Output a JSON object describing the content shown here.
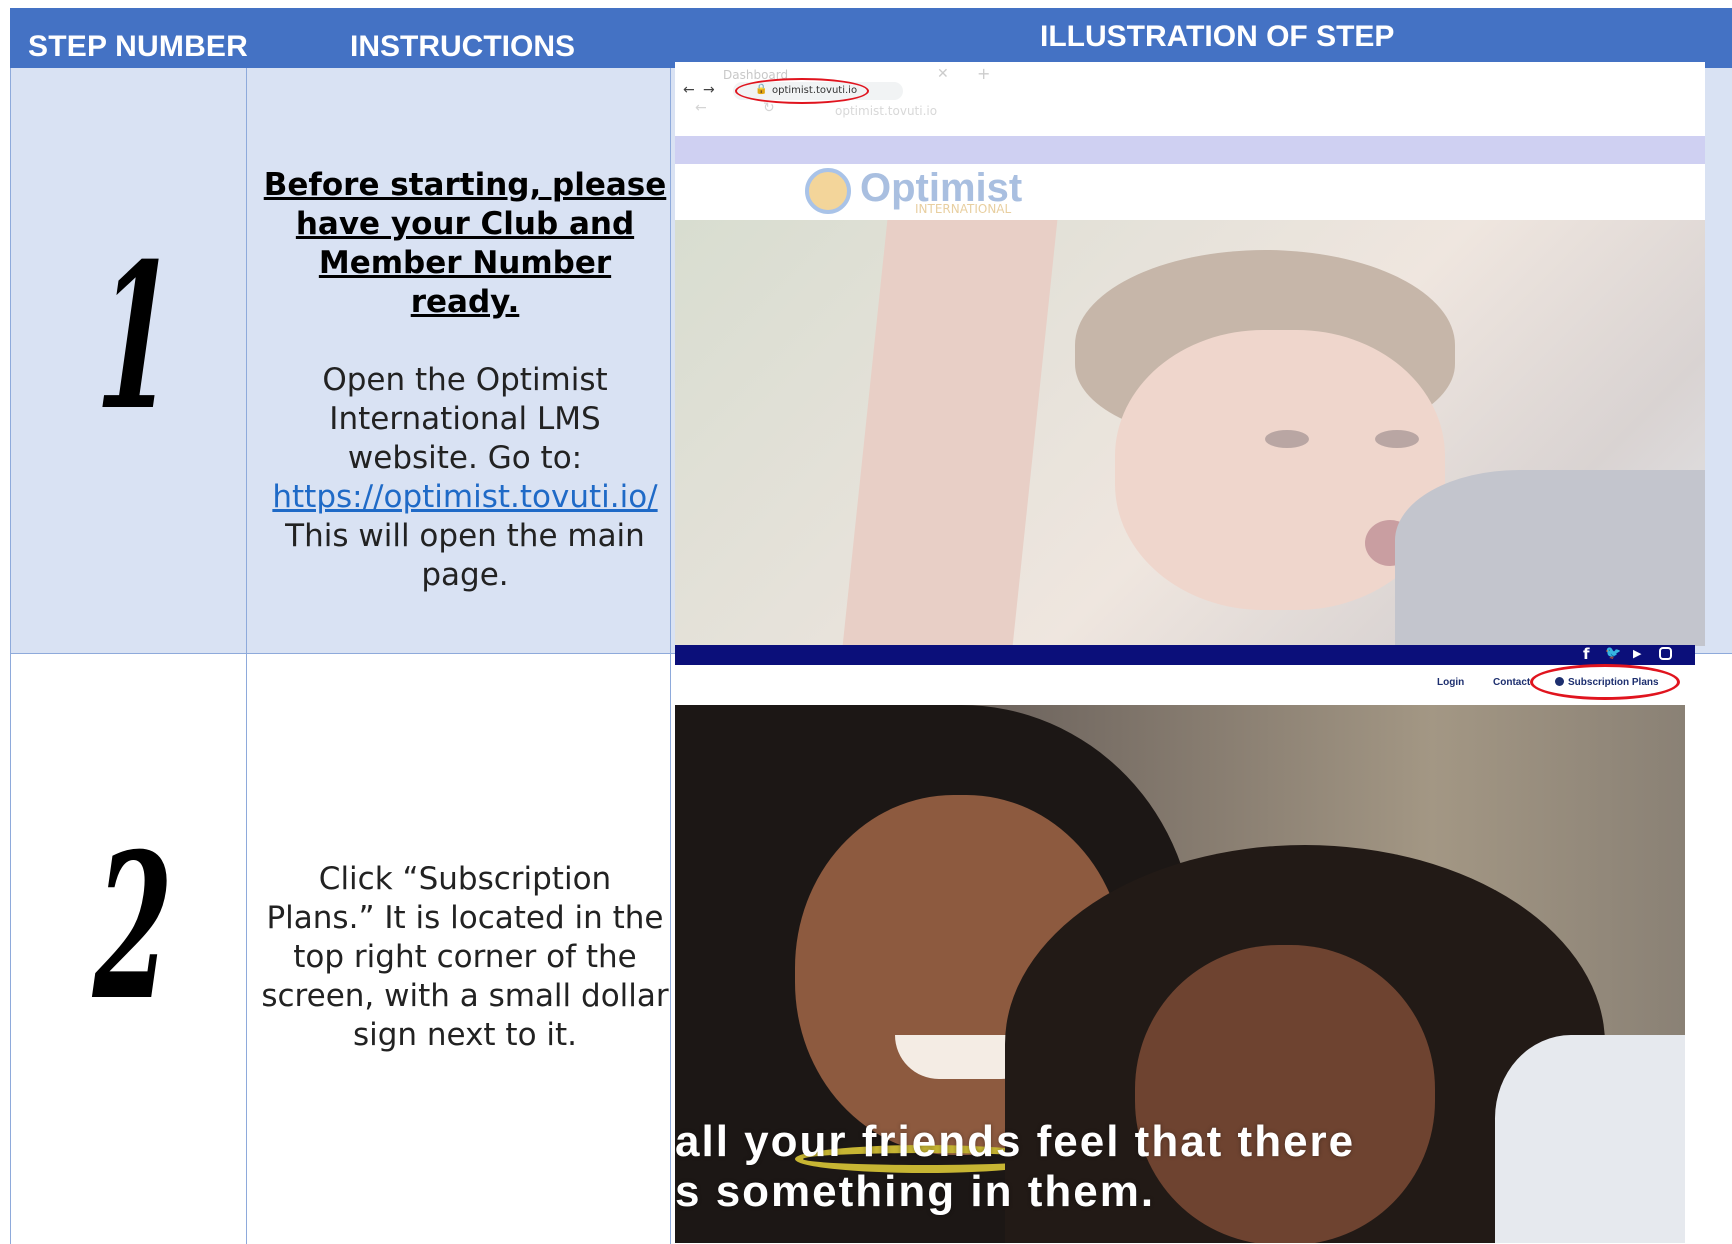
{
  "header": {
    "step_number": "STEP NUMBER",
    "instructions": "INSTRUCTIONS",
    "illustration": "ILLUSTRATION OF STEP"
  },
  "rows": [
    {
      "number": "1",
      "instruction_bold": "Before starting, please have your Club and Member Number ready.",
      "instruction_text": "Open the Optimist International LMS website. Go to:",
      "link": "https://optimist.tovuti.io/",
      "instruction_after": "This will open the main page.",
      "screenshot": {
        "tab_label": "Dashboard",
        "url": "optimist.tovuti.io",
        "url_ghost": "optimist.tovuti.io",
        "logo_word": "Optimist",
        "logo_sub": "INTERNATIONAL"
      }
    },
    {
      "number": "2",
      "instruction_text": "Click “Subscription Plans.” It is located in the top right corner of the screen, with a small dollar sign next to it.",
      "screenshot": {
        "nav_login": "Login",
        "nav_contact": "Contact",
        "nav_subscription": "Subscription Plans",
        "caption_line1": "all your friends feel that there",
        "caption_line2": "s something in them."
      }
    }
  ],
  "colors": {
    "header_bg": "#4472c4",
    "row1_bg": "#d9e2f3",
    "grid": "#8eaadb",
    "link": "#1f6ac7",
    "highlight_red": "#e0141e",
    "navy_bar": "#0b0f7a"
  }
}
